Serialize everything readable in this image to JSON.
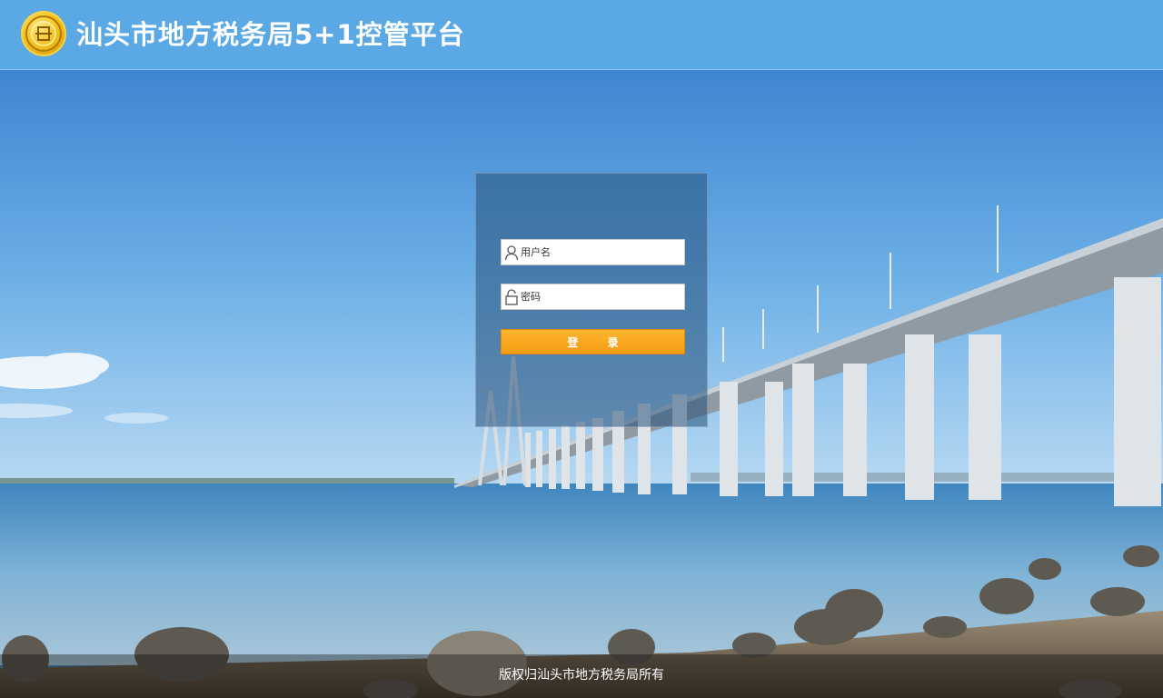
{
  "header": {
    "title": "汕头市地方税务局5+1控管平台",
    "logo_icon": "tax-emblem-icon"
  },
  "login": {
    "username_placeholder": "用户名",
    "password_placeholder": "密码",
    "username_icon": "user-icon",
    "password_icon": "lock-icon",
    "submit_label": "登 录"
  },
  "footer": {
    "copyright": "版权归汕头市地方税务局所有"
  },
  "colors": {
    "header_bg": "#5aa9e4",
    "button_bg": "#f5a31a",
    "panel_bg": "#3f6f99"
  }
}
